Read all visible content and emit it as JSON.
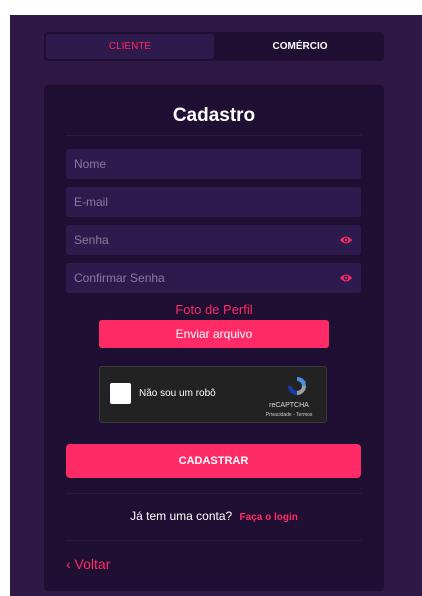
{
  "tabs": [
    {
      "label": "CLIENTE"
    },
    {
      "label": "COMÉRCIO"
    }
  ],
  "form": {
    "title": "Cadastro",
    "fields": [
      {
        "placeholder": "Nome"
      },
      {
        "placeholder": "E-mail"
      },
      {
        "placeholder": "Senha"
      },
      {
        "placeholder": "Confirmar Senha"
      }
    ],
    "photo_label": "Foto de Perfil",
    "upload_label": "Enviar arquivo",
    "captcha": {
      "checkbox_label": "Não sou um robô",
      "brand": "reCAPTCHA",
      "links": "Privacidade - Termos"
    },
    "submit_label": "CADASTRAR",
    "login_prompt": "Já tem uma conta?",
    "login_link": "Faça o login",
    "back_label": "‹ Voltar"
  },
  "colors": {
    "accent": "#ff2a66",
    "background": "#2d1846",
    "card": "#1f0f33",
    "field": "#2e1b4d"
  },
  "icons": [
    "eye-icon",
    "recaptcha-logo-icon"
  ]
}
